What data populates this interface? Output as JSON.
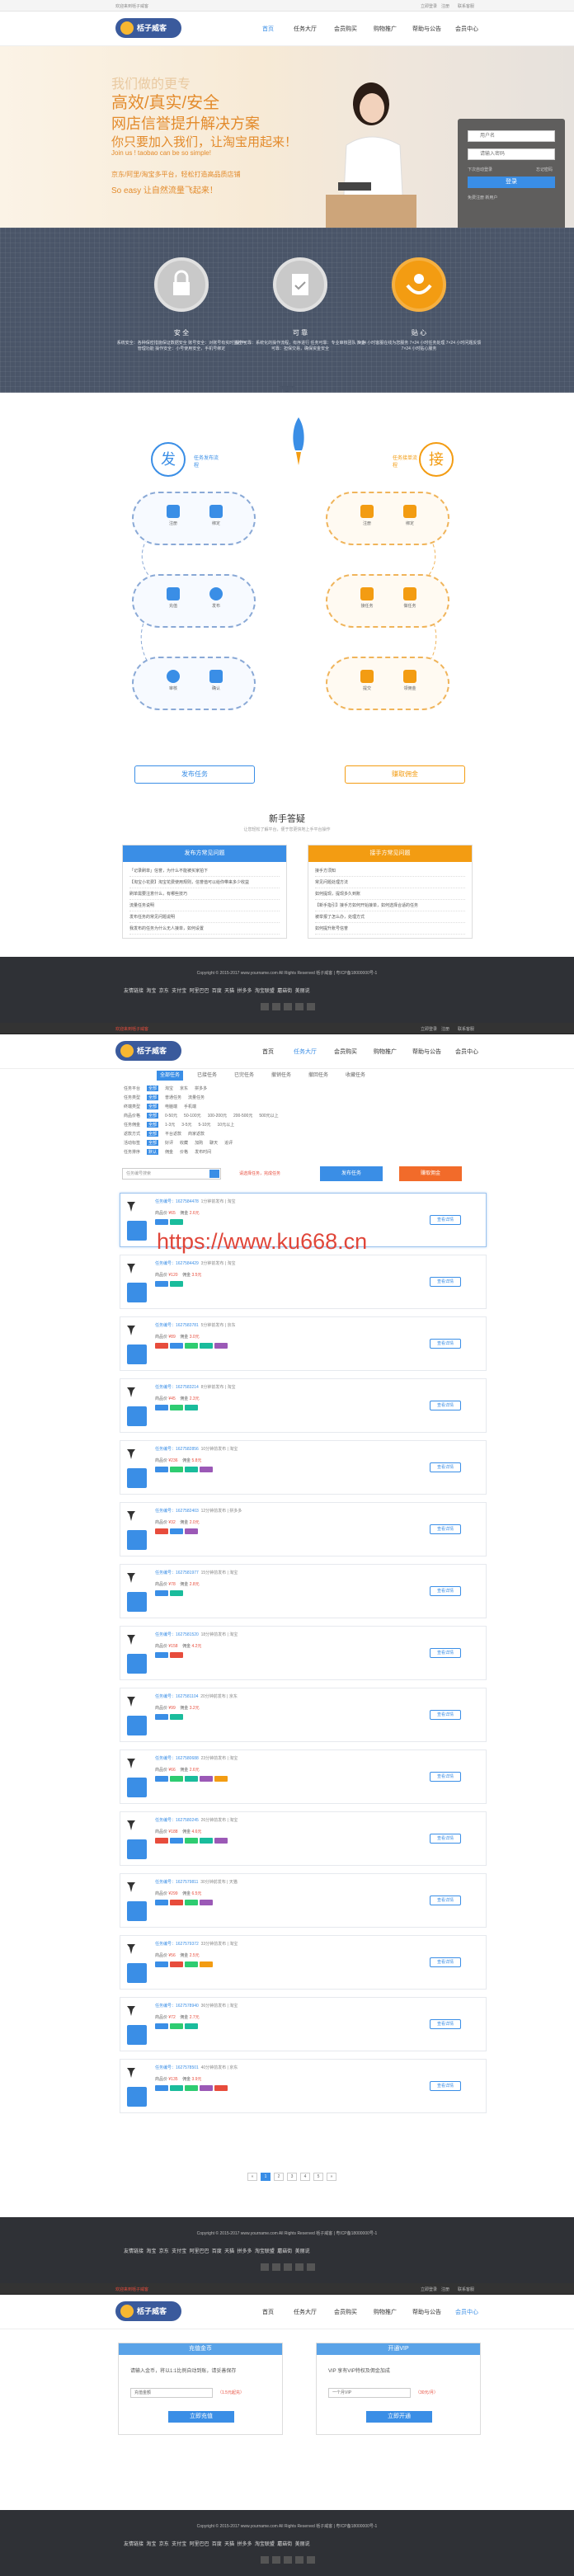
{
  "site": {
    "logo": "栝子威客",
    "topbar_left": "欢迎来到栝子威客",
    "topbar_right": [
      "立即登录",
      "注册",
      "联系客服"
    ]
  },
  "nav": [
    "首页",
    "任务大厅",
    "会员购买",
    "购物推广",
    "帮助与公告",
    "会员中心"
  ],
  "hero": {
    "line1": "我们做的更专",
    "line2": "高效/真实/安全",
    "line3": "网店信誉提升解决方案",
    "line4": "你只要加入我们，让淘宝用起来！",
    "line5": "Join us ! taobao can be so simple!",
    "line6": "京东/阿里/淘宝多平台，轻松打造高品质店铺",
    "line7": "So easy 让自然流量飞起来！"
  },
  "login": {
    "user_placeholder": "用户名",
    "pass_placeholder": "请输入密码",
    "remember": "下次自动登录",
    "forgot": "忘记密码",
    "button": "登录",
    "register": "免费注册 新用户"
  },
  "features": [
    {
      "title": "安 全",
      "icon": "lock-icon",
      "desc": "系统安全：各种保密措施保证数据安全 账号安全：对账号有实时监控与管理功能 操作安全：小号使用安全，手机号绑定"
    },
    {
      "title": "可 靠",
      "icon": "clipboard-check-icon",
      "desc": "操作可靠：系统化的操作流程，有序进行 任务可靠：专业审核团队 资金可靠：担保交易，确保资金安全"
    },
    {
      "title": "贴 心",
      "icon": "hands-icon",
      "desc": "7×24 小时客服在线为您服务 7×24 小时任务处理 7×24 小时问题反馈 7×24 小时贴心服务"
    }
  ],
  "process": {
    "left_badge": "发",
    "left_label": "任务发布流程",
    "right_badge": "接",
    "right_label": "任务接单流程",
    "left_steps": [
      [
        "注册",
        "绑定"
      ],
      [
        "充值",
        "发布"
      ],
      [
        "审核",
        "确认"
      ]
    ],
    "right_steps": [
      [
        "注册",
        "绑定"
      ],
      [
        "接任务",
        "做任务"
      ],
      [
        "提交",
        "领佣金"
      ]
    ],
    "left_button": "发布任务",
    "right_button": "赚取佣金"
  },
  "novice": {
    "title": "新手答疑",
    "subtitle": "让您轻松了解平台，便于您更快地上手平台操作",
    "left_head": "发布方常见问题",
    "right_head": "接手方常见问题",
    "left_items": [
      "「记录刷单」信誉，为什么不能被买家拍下",
      "【淘宝小花费】淘宝花费使用规则，信誉值可以给你带来多少收益",
      "刷单需要注意什么，有哪些技巧",
      "流量任务说明",
      "发布任务的常见问题说明",
      "我发布的任务为什么无人接单，如何设置"
    ],
    "right_items": [
      "接手方须知",
      "常见问题处理方法",
      "如何提现，提现多久到账",
      "【新手指引】接手方如何开始接单，如何选择合适的任务",
      "被举报了怎么办，处理方式",
      "如何提升账号信誉"
    ]
  },
  "footer": {
    "copyright": "Copyright © 2015-2017 www.yourname.com All Rights Reserved 栝子威客 | 粤ICP备18000000号-1",
    "links": [
      "友情链接",
      "淘宝",
      "京东",
      "支付宝",
      "阿里巴巴",
      "百度",
      "天猫",
      "拼多多",
      "淘宝联盟",
      "蘑菇街",
      "美丽说"
    ]
  },
  "listing": {
    "tabs": [
      "全部任务",
      "已接任务",
      "已完任务",
      "撤销任务",
      "撤回任务",
      "收藏任务"
    ],
    "filter_rows": [
      [
        "任务平台",
        "全部",
        "淘宝",
        "京东",
        "拼多多"
      ],
      [
        "任务类型",
        "全部",
        "普通任务",
        "流量任务"
      ],
      [
        "终端类型",
        "全部",
        "电脑端",
        "手机端"
      ],
      [
        "商品价格",
        "全部",
        "0-50元",
        "50-100元",
        "100-200元",
        "200-500元",
        "500元以上"
      ],
      [
        "任务佣金",
        "全部",
        "1-3元",
        "3-5元",
        "5-10元",
        "10元以上"
      ],
      [
        "返款方式",
        "全部",
        "平台返款",
        "商家返款"
      ],
      [
        "活动标签",
        "全部",
        "好评",
        "收藏",
        "加购",
        "聊天",
        "追评"
      ],
      [
        "任务排序",
        "默认",
        "佣金",
        "价格",
        "发布时间"
      ]
    ],
    "search_placeholder": "任务编号搜索",
    "notice": "请选择任务，完成任务",
    "publish_button": "发布任务",
    "earn_button": "赚取佣金",
    "watermark": "https://www.ku668.cn",
    "tasks": [
      {
        "id": "任务编号：1627584478",
        "meta": "1分钟前发布 | 淘宝",
        "price": "¥65",
        "commission": "2.6元",
        "tags": [
          "#3a8ee6",
          "#1abc9c"
        ]
      },
      {
        "id": "任务编号：1627584429",
        "meta": "3分钟前发布 | 淘宝",
        "price": "¥120",
        "commission": "3.5元",
        "tags": [
          "#3a8ee6",
          "#1abc9c"
        ]
      },
      {
        "id": "任务编号：1627583781",
        "meta": "5分钟前发布 | 京东",
        "price": "¥89",
        "commission": "3.0元",
        "tags": [
          "#e74c3c",
          "#3a8ee6",
          "#2ecc71",
          "#1abc9c",
          "#9b59b6"
        ]
      },
      {
        "id": "任务编号：1627583214",
        "meta": "8分钟前发布 | 淘宝",
        "price": "¥45",
        "commission": "2.3元",
        "tags": [
          "#3a8ee6",
          "#2ecc71",
          "#1abc9c"
        ]
      },
      {
        "id": "任务编号：1627582856",
        "meta": "10分钟前发布 | 淘宝",
        "price": "¥236",
        "commission": "5.8元",
        "tags": [
          "#3a8ee6",
          "#2ecc71",
          "#1abc9c",
          "#9b59b6"
        ]
      },
      {
        "id": "任务编号：1627582403",
        "meta": "12分钟前发布 | 拼多多",
        "price": "¥32",
        "commission": "2.0元",
        "tags": [
          "#e74c3c",
          "#3a8ee6",
          "#9b59b6"
        ]
      },
      {
        "id": "任务编号：1627581977",
        "meta": "15分钟前发布 | 淘宝",
        "price": "¥78",
        "commission": "2.8元",
        "tags": [
          "#3a8ee6",
          "#1abc9c"
        ]
      },
      {
        "id": "任务编号：1627581520",
        "meta": "18分钟前发布 | 淘宝",
        "price": "¥158",
        "commission": "4.2元",
        "tags": [
          "#3a8ee6",
          "#e74c3c"
        ]
      },
      {
        "id": "任务编号：1627581104",
        "meta": "20分钟前发布 | 京东",
        "price": "¥99",
        "commission": "3.2元",
        "tags": [
          "#3a8ee6",
          "#1abc9c"
        ]
      },
      {
        "id": "任务编号：1627580688",
        "meta": "23分钟前发布 | 淘宝",
        "price": "¥66",
        "commission": "2.6元",
        "tags": [
          "#3a8ee6",
          "#2ecc71",
          "#1abc9c",
          "#9b59b6",
          "#f39c12"
        ]
      },
      {
        "id": "任务编号：1627580245",
        "meta": "26分钟前发布 | 淘宝",
        "price": "¥188",
        "commission": "4.6元",
        "tags": [
          "#e74c3c",
          "#3a8ee6",
          "#2ecc71",
          "#1abc9c",
          "#9b59b6"
        ]
      },
      {
        "id": "任务编号：1627579811",
        "meta": "30分钟前发布 | 天猫",
        "price": "¥299",
        "commission": "6.5元",
        "tags": [
          "#3a8ee6",
          "#e74c3c",
          "#2ecc71",
          "#9b59b6"
        ]
      },
      {
        "id": "任务编号：1627579372",
        "meta": "33分钟前发布 | 淘宝",
        "price": "¥56",
        "commission": "2.5元",
        "tags": [
          "#3a8ee6",
          "#e74c3c",
          "#2ecc71",
          "#f39c12"
        ]
      },
      {
        "id": "任务编号：1627578940",
        "meta": "36分钟前发布 | 淘宝",
        "price": "¥72",
        "commission": "2.7元",
        "tags": [
          "#3a8ee6",
          "#2ecc71",
          "#1abc9c"
        ]
      },
      {
        "id": "任务编号：1627578501",
        "meta": "40分钟前发布 | 京东",
        "price": "¥135",
        "commission": "3.9元",
        "tags": [
          "#3a8ee6",
          "#1abc9c",
          "#2ecc71",
          "#9b59b6",
          "#e74c3c"
        ]
      }
    ],
    "pages": [
      "«",
      "1",
      "2",
      "3",
      "4",
      "5",
      "»"
    ]
  },
  "recharge": {
    "left_head": "充值金币",
    "left_text": "请输入金币，将以1:1比例自动到账，请妥善保存",
    "left_field": "充值金额",
    "left_amount": "（1.5元起充）",
    "left_button": "立即充值",
    "right_head": "开通VIP",
    "right_text": "VIP 享有VIP特权及佣金加成",
    "right_field": "一个月VIP",
    "right_amount": "（30元/月）",
    "right_button": "立即开通"
  },
  "colors": {
    "accent": "#3a8ee6",
    "orange": "#f39c12",
    "dark": "#2f3136",
    "band": "#4a5568"
  }
}
